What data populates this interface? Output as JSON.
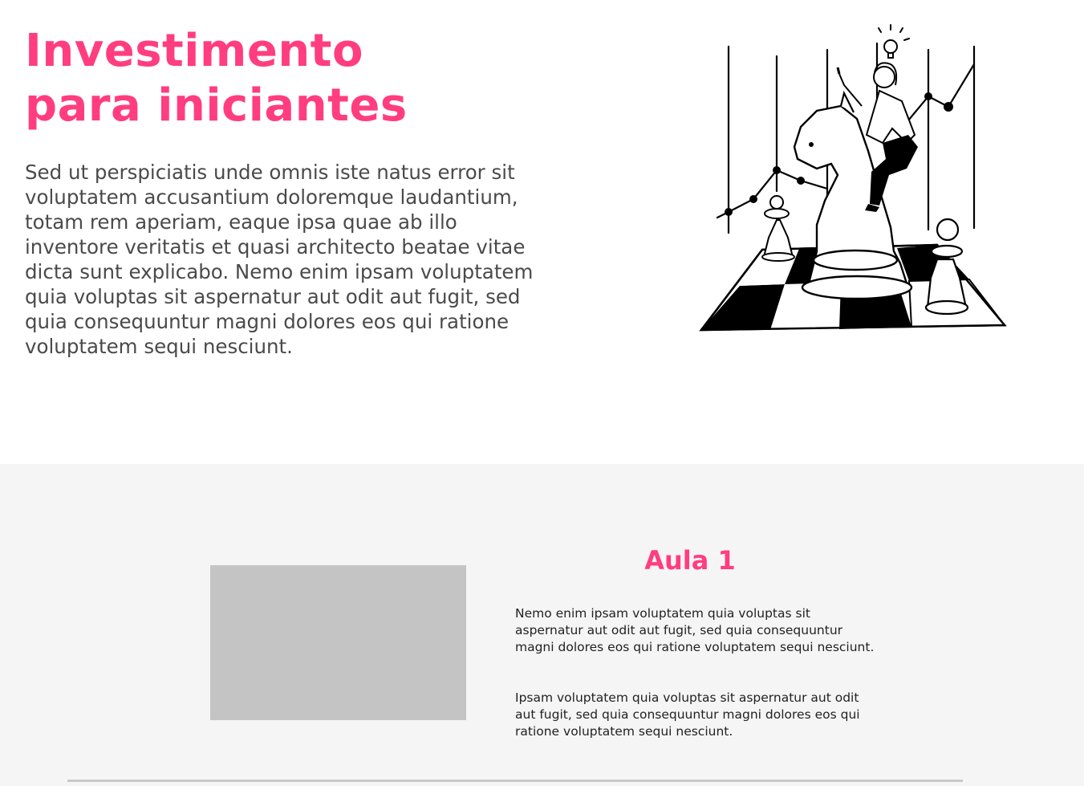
{
  "hero": {
    "title_line1": "Investimento",
    "title_line2": "para iniciantes",
    "paragraph": "Sed ut perspiciatis unde omnis iste natus error sit voluptatem accusantium doloremque laudantium, totam rem aperiam, eaque ipsa quae ab illo inventore veritatis et quasi architecto beatae vitae dicta sunt explicabo. Nemo enim ipsam voluptatem quia voluptas sit aspernatur aut odit aut fugit, sed quia consequuntur magni dolores eos qui ratione voluptatem sequi nesciunt."
  },
  "lesson": {
    "title": "Aula 1",
    "paragraph1": "Nemo enim ipsam voluptatem quia voluptas sit aspernatur aut odit aut fugit, sed quia consequuntur magni dolores eos qui ratione voluptatem sequi nesciunt.",
    "paragraph2": "Ipsam voluptatem quia voluptas sit aspernatur aut odit aut fugit, sed quia consequuntur magni dolores eos qui ratione voluptatem sequi nesciunt."
  },
  "icons": {
    "hero_illustration": "chess-knight-rider-illustration",
    "video": "video-placeholder"
  },
  "colors": {
    "accent": "#ff3d7f",
    "hero_text": "#4a4a4a",
    "section_bg": "#f5f5f5",
    "placeholder": "#c4c4c4"
  }
}
